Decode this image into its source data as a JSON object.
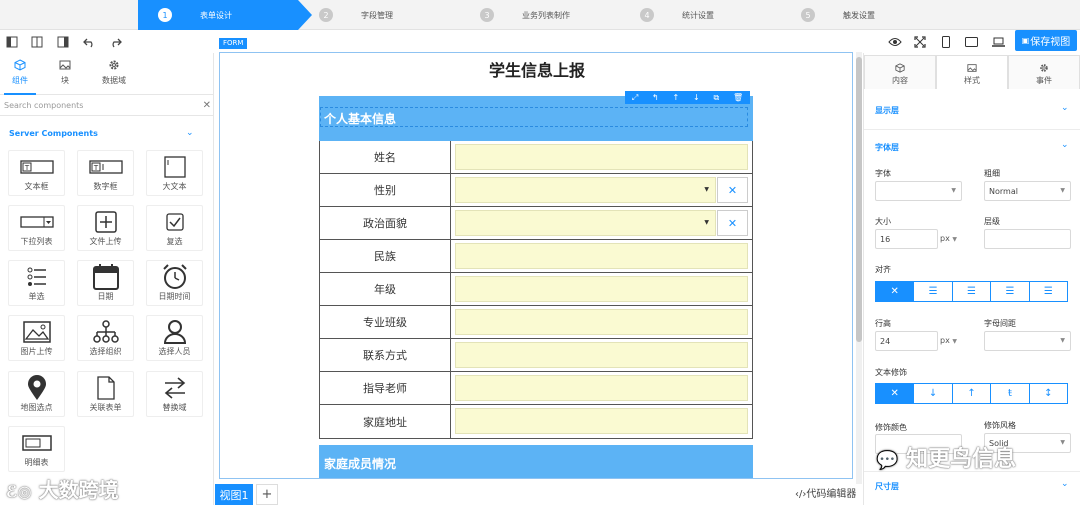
{
  "steps": [
    {
      "num": "1",
      "label": "表单设计"
    },
    {
      "num": "2",
      "label": "字段管理"
    },
    {
      "num": "3",
      "label": "业务列表制作"
    },
    {
      "num": "4",
      "label": "统计设置"
    },
    {
      "num": "5",
      "label": "触发设置"
    }
  ],
  "toolbar": {
    "save_label": "保存视图"
  },
  "left_panel": {
    "tabs": [
      {
        "label": "组件",
        "icon": "cube-icon"
      },
      {
        "label": "块",
        "icon": "image-icon"
      },
      {
        "label": "数据域",
        "icon": "gear-icon"
      }
    ],
    "search_placeholder": "Search components",
    "group_title": "Server Components",
    "components": [
      {
        "label": "文本框",
        "icon": "textbox-icon"
      },
      {
        "label": "数字框",
        "icon": "number-box-icon"
      },
      {
        "label": "大文本",
        "icon": "textarea-icon"
      },
      {
        "label": "下拉列表",
        "icon": "dropdown-icon"
      },
      {
        "label": "文件上传",
        "icon": "upload-icon"
      },
      {
        "label": "复选",
        "icon": "checkbox-icon"
      },
      {
        "label": "单选",
        "icon": "radio-list-icon"
      },
      {
        "label": "日期",
        "icon": "calendar-icon"
      },
      {
        "label": "日期时间",
        "icon": "alarm-clock-icon"
      },
      {
        "label": "图片上传",
        "icon": "picture-icon"
      },
      {
        "label": "选择组织",
        "icon": "org-tree-icon"
      },
      {
        "label": "选择人员",
        "icon": "person-icon"
      },
      {
        "label": "地图选点",
        "icon": "map-pin-icon"
      },
      {
        "label": "关联表单",
        "icon": "file-icon"
      },
      {
        "label": "替换域",
        "icon": "swap-arrows-icon"
      },
      {
        "label": "明细表",
        "icon": "detail-table-icon"
      }
    ]
  },
  "canvas": {
    "tag": "FORM",
    "title": "学生信息上报",
    "section1_title": "个人基本信息",
    "section2_title": "家庭成员情况",
    "rows": [
      {
        "label": "姓名",
        "type": "text"
      },
      {
        "label": "性别",
        "type": "select"
      },
      {
        "label": "政治面貌",
        "type": "select"
      },
      {
        "label": "民族",
        "type": "text"
      },
      {
        "label": "年级",
        "type": "text"
      },
      {
        "label": "专业班级",
        "type": "text"
      },
      {
        "label": "联系方式",
        "type": "text"
      },
      {
        "label": "指导老师",
        "type": "text"
      },
      {
        "label": "家庭地址",
        "type": "text"
      }
    ]
  },
  "bottom": {
    "view_tab": "视图1",
    "add_label": "+",
    "code_editor": "‹/›代码编辑器"
  },
  "right_panel": {
    "tabs": [
      {
        "label": "内容",
        "icon": "cube-icon"
      },
      {
        "label": "样式",
        "icon": "image-icon"
      },
      {
        "label": "事件",
        "icon": "gear-icon"
      }
    ],
    "sections": {
      "display": "显示层",
      "font": "字体层",
      "decoration": "文本修饰",
      "size": "尺寸层"
    },
    "labels": {
      "font": "字体",
      "weight": "粗细",
      "size": "大小",
      "level": "层级",
      "align": "对齐",
      "line_height": "行高",
      "letter_spacing": "字母间距",
      "deco_color": "修饰颜色",
      "deco_style": "修饰风格"
    },
    "values": {
      "weight": "Normal",
      "size": "16",
      "size_unit": "px",
      "line_height": "24",
      "line_unit": "px",
      "deco_style": "Solid"
    }
  },
  "watermarks": {
    "left": "大数跨境",
    "right": "知更鸟信息"
  },
  "colors": {
    "accent": "#1890ff",
    "section_bg": "#5cb3f5",
    "input_bg": "#fafad2"
  }
}
